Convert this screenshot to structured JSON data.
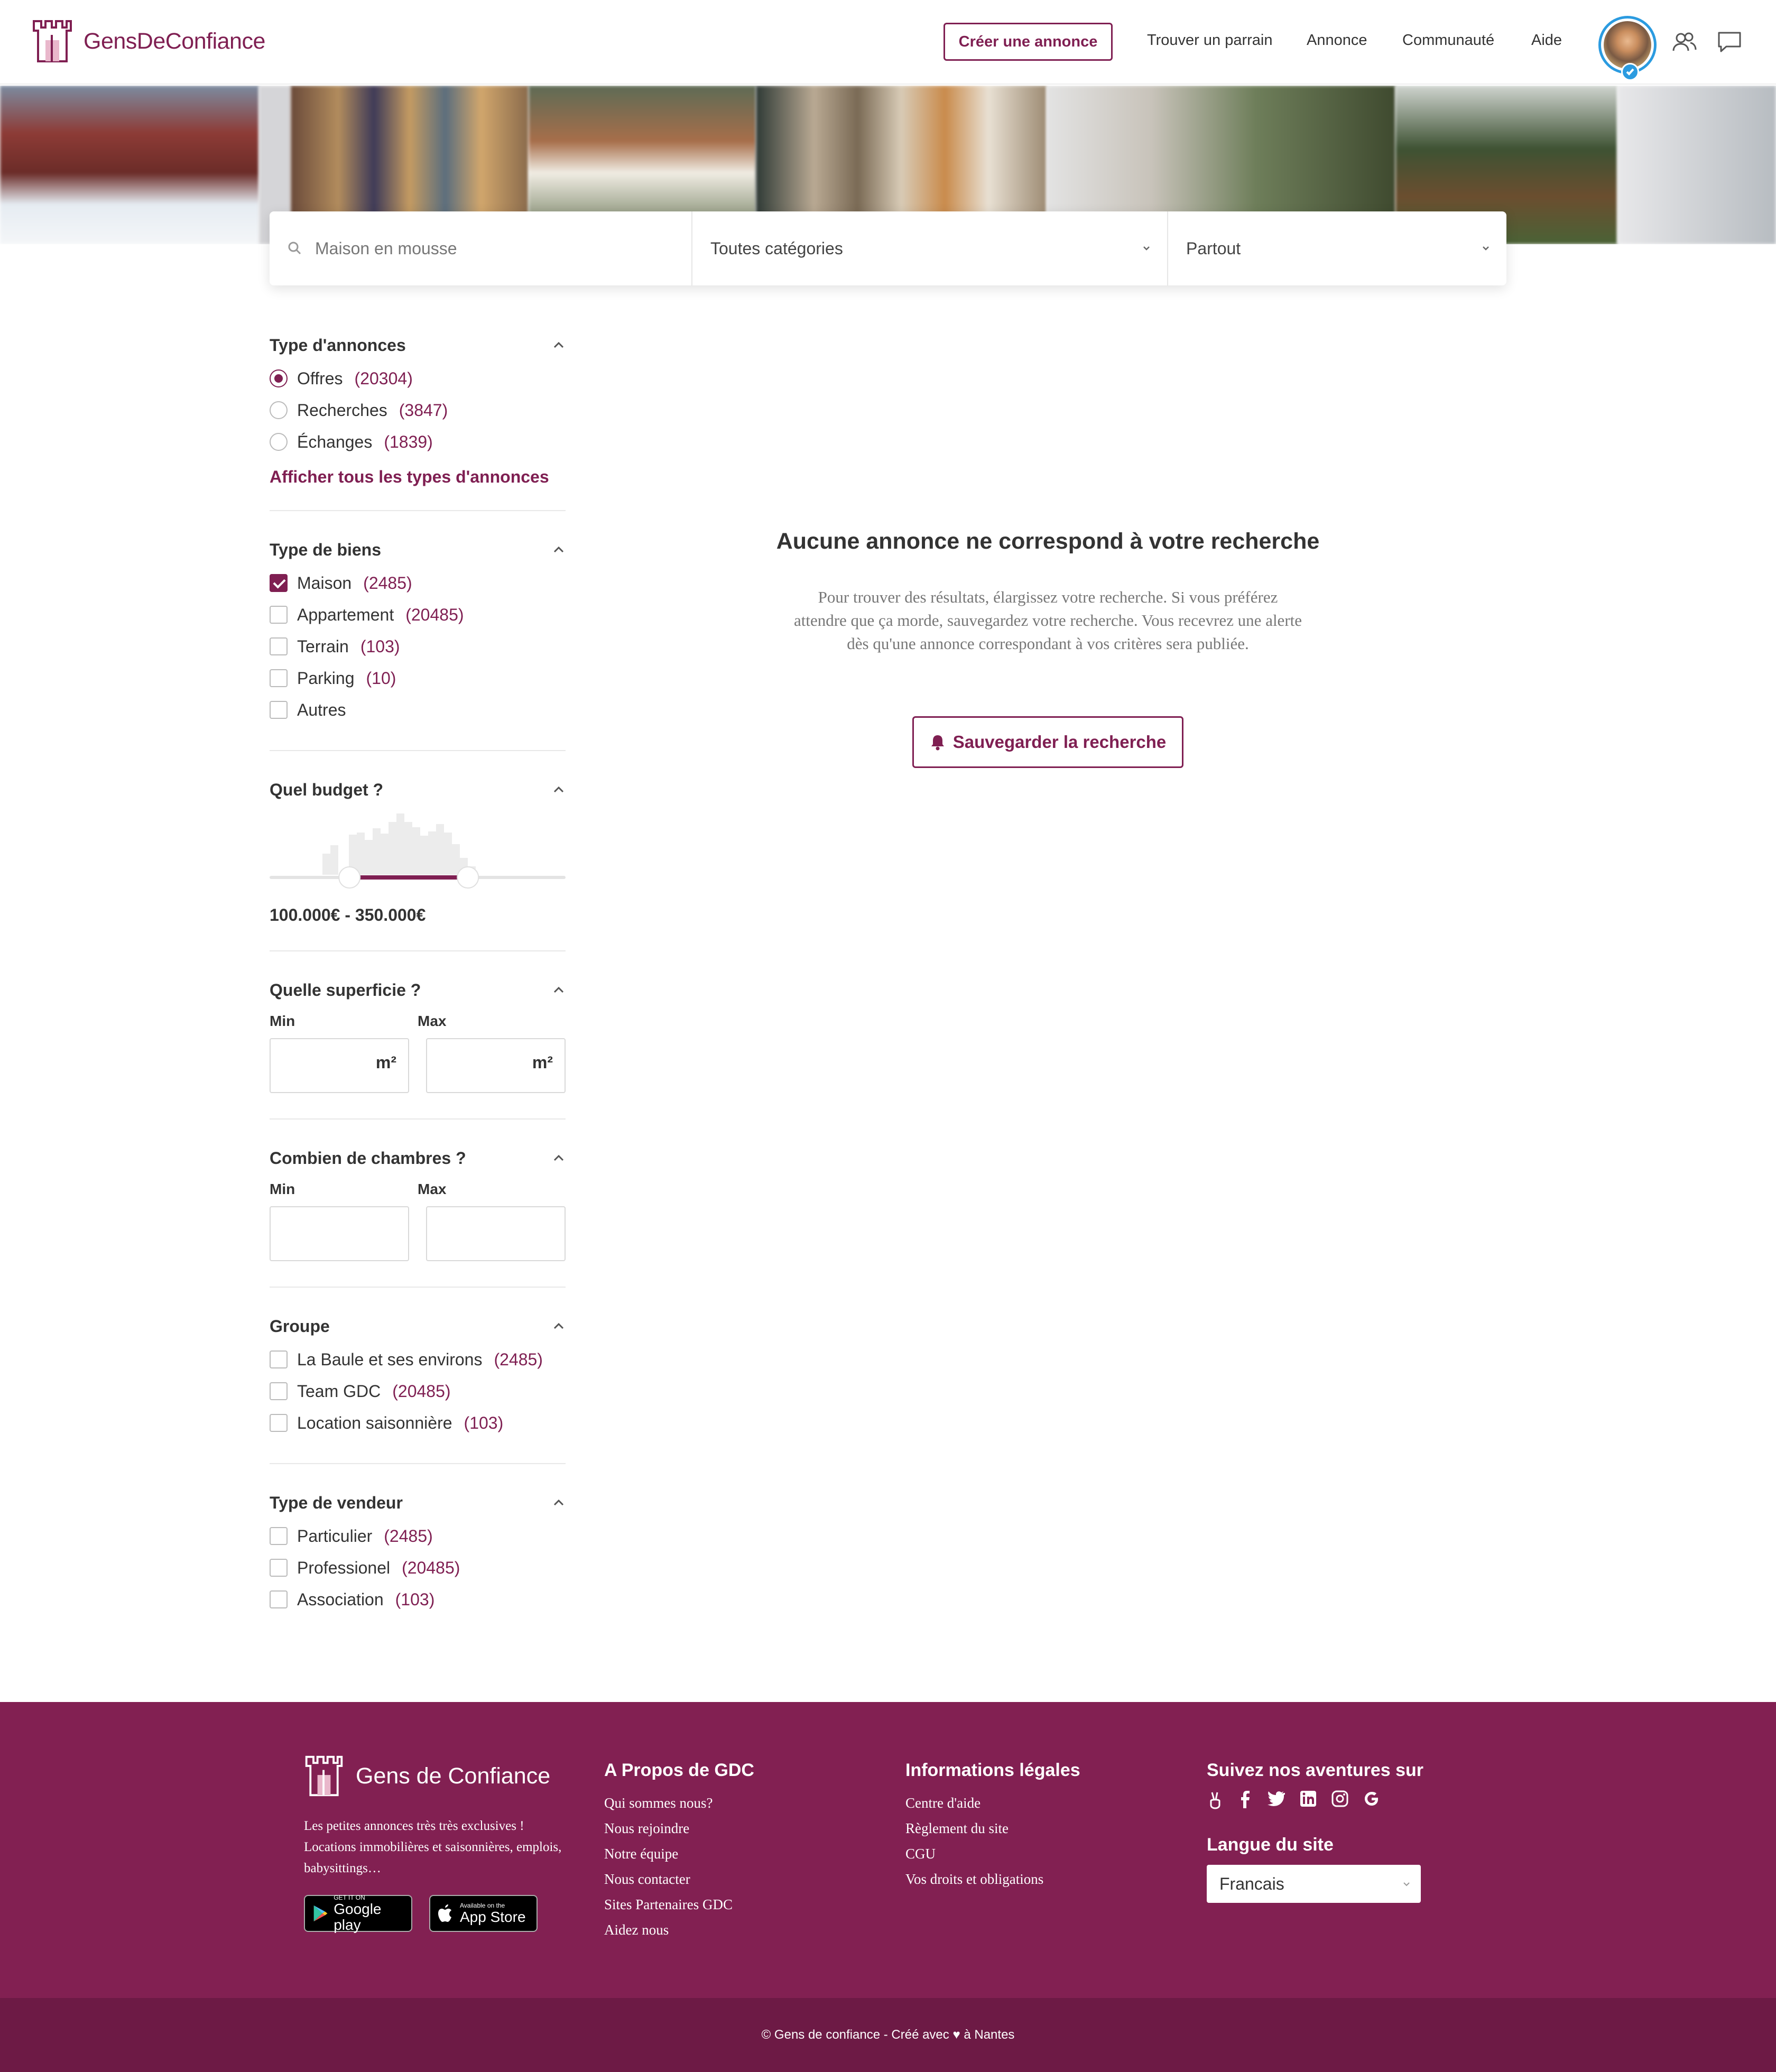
{
  "header": {
    "logo_text": "GensDeConfiance",
    "create_label": "Créer une annonce",
    "nav": [
      "Trouver un parrain",
      "Annonce",
      "Communauté",
      "Aide"
    ]
  },
  "search": {
    "placeholder": "Maison en mousse",
    "category": "Toutes catégories",
    "location": "Partout"
  },
  "filters": {
    "ad_type": {
      "title": "Type d'annonces",
      "options": [
        {
          "label": "Offres",
          "count": "(20304)",
          "selected": true
        },
        {
          "label": "Recherches",
          "count": "(3847)",
          "selected": false
        },
        {
          "label": "Échanges",
          "count": "(1839)",
          "selected": false
        }
      ],
      "show_all": "Afficher tous les types d'annonces"
    },
    "property_type": {
      "title": "Type de biens",
      "options": [
        {
          "label": "Maison",
          "count": "(2485)",
          "checked": true
        },
        {
          "label": "Appartement",
          "count": "(20485)",
          "checked": false
        },
        {
          "label": "Terrain",
          "count": "(103)",
          "checked": false
        },
        {
          "label": "Parking",
          "count": "(10)",
          "checked": false
        },
        {
          "label": "Autres",
          "count": "",
          "checked": false
        }
      ]
    },
    "budget": {
      "title": "Quel budget ?",
      "range_text": "100.000€ - 350.000€",
      "selected_from_fraction": 0.27,
      "selected_to_fraction": 0.67
    },
    "surface": {
      "title": "Quelle superficie ?",
      "min_label": "Min",
      "max_label": "Max",
      "unit": "m²"
    },
    "bedrooms": {
      "title": "Combien de chambres ?",
      "min_label": "Min",
      "max_label": "Max"
    },
    "group": {
      "title": "Groupe",
      "options": [
        {
          "label": "La Baule et ses environs",
          "count": "(2485)"
        },
        {
          "label": "Team GDC",
          "count": "(20485)"
        },
        {
          "label": "Location saisonnière",
          "count": "(103)"
        }
      ]
    },
    "seller_type": {
      "title": "Type de vendeur",
      "options": [
        {
          "label": "Particulier",
          "count": "(2485)"
        },
        {
          "label": "Professionel",
          "count": "(20485)"
        },
        {
          "label": "Association",
          "count": "(103)"
        }
      ]
    }
  },
  "empty": {
    "title": "Aucune annonce ne correspond à votre recherche",
    "text": "Pour trouver des résultats, élargissez votre recherche. Si vous préférez attendre que ça morde, sauvegardez votre recherche. Vous recevrez une alerte dès qu'une annonce correspondant à vos critères sera publiée.",
    "save_label": "Sauvegarder la recherche"
  },
  "footer": {
    "logo_text": "Gens de Confiance",
    "tagline": "Les petites annonces très très exclusives ! Locations immobilières et saisonnières, emplois, babysittings…",
    "google_small": "GET IT ON",
    "google_big": "Google play",
    "apple_small": "Available on the",
    "apple_big": "App Store",
    "about_title": "A Propos de GDC",
    "about_links": [
      "Qui sommes nous?",
      "Nous rejoindre",
      "Notre équipe",
      "Nous contacter",
      "Sites Partenaires GDC",
      "Aidez nous"
    ],
    "legal_title": "Informations légales",
    "legal_links": [
      "Centre d'aide",
      "Règlement du site",
      "CGU",
      "Vos droits et obligations"
    ],
    "social_title": "Suivez nos aventures sur",
    "lang_title": "Langue du site",
    "lang_value": "Francais",
    "copyright": "© Gens de confiance - Créé avec ♥ à Nantes"
  },
  "colors": {
    "brand": "#7f1f52",
    "footer_bg": "#822052",
    "verified": "#2b9be0"
  }
}
